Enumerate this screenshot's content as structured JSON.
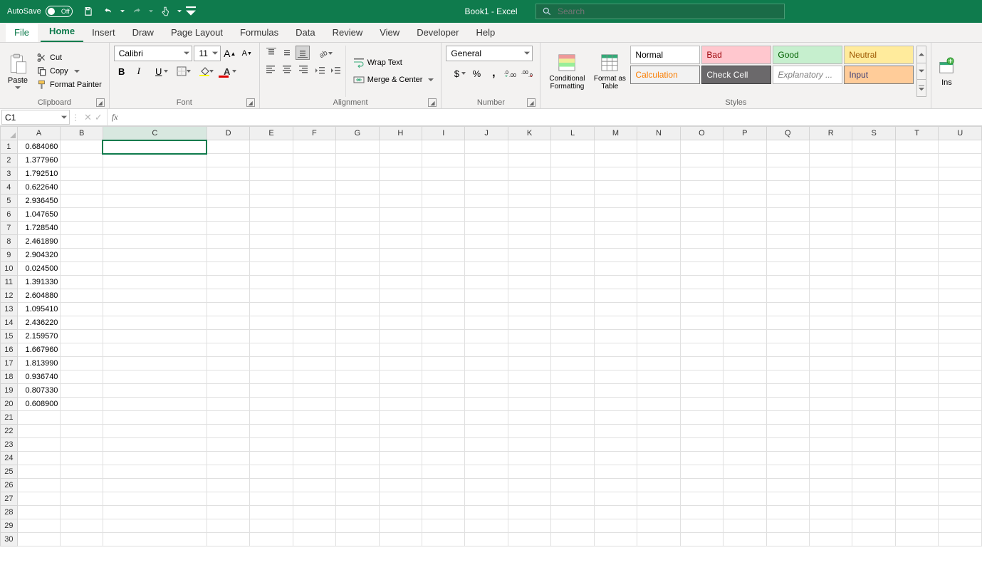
{
  "titlebar": {
    "autosave_label": "AutoSave",
    "autosave_state": "Off",
    "doc_title": "Book1  -  Excel",
    "search_placeholder": "Search"
  },
  "tabs": [
    "File",
    "Home",
    "Insert",
    "Draw",
    "Page Layout",
    "Formulas",
    "Data",
    "Review",
    "View",
    "Developer",
    "Help"
  ],
  "active_tab": "Home",
  "ribbon": {
    "clipboard": {
      "label": "Clipboard",
      "paste": "Paste",
      "cut": "Cut",
      "copy": "Copy",
      "painter": "Format Painter"
    },
    "font": {
      "label": "Font",
      "name": "Calibri",
      "size": "11"
    },
    "alignment": {
      "label": "Alignment",
      "wrap": "Wrap Text",
      "merge": "Merge & Center"
    },
    "number": {
      "label": "Number",
      "format": "General"
    },
    "styles": {
      "label": "Styles",
      "cond": "Conditional Formatting",
      "table": "Format as Table",
      "swatches": [
        "Normal",
        "Bad",
        "Good",
        "Neutral",
        "Calculation",
        "Check Cell",
        "Explanatory ...",
        "Input"
      ]
    },
    "insert_partial": "Ins"
  },
  "namebox": "C1",
  "formula": "",
  "columns": [
    "A",
    "B",
    "C",
    "D",
    "E",
    "F",
    "G",
    "H",
    "I",
    "J",
    "K",
    "L",
    "M",
    "N",
    "O",
    "P",
    "Q",
    "R",
    "S",
    "T",
    "U"
  ],
  "selected_cell": "C1",
  "rows": 30,
  "data_col_A": [
    "0.684060",
    "1.377960",
    "1.792510",
    "0.622640",
    "2.936450",
    "1.047650",
    "1.728540",
    "2.461890",
    "2.904320",
    "0.024500",
    "1.391330",
    "2.604880",
    "1.095410",
    "2.436220",
    "2.159570",
    "1.667960",
    "1.813990",
    "0.936740",
    "0.807330",
    "0.608900"
  ]
}
